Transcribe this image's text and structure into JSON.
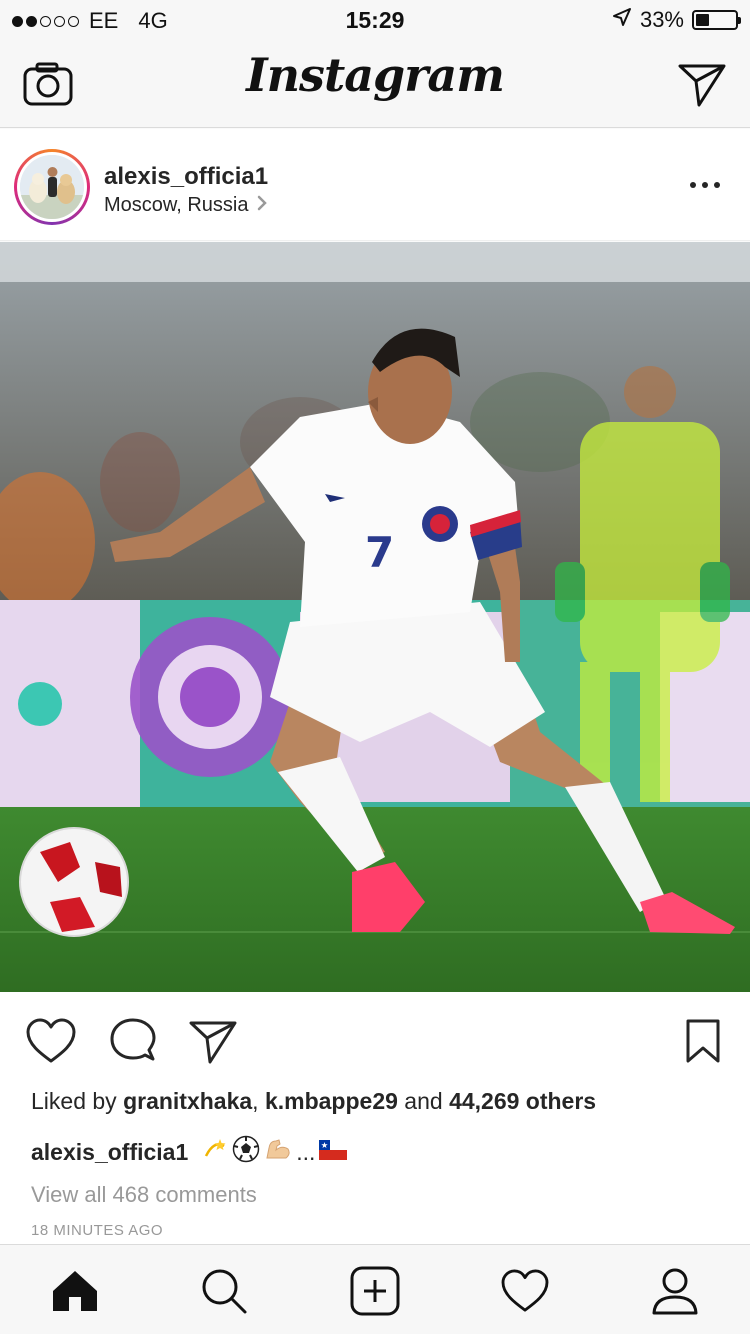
{
  "status_bar": {
    "carrier": "EE",
    "network": "4G",
    "time": "15:29",
    "battery": "33%",
    "battery_level": 0.33,
    "signal_bars": 2
  },
  "nav": {
    "brand": "Instagram",
    "left_icon": "camera-icon",
    "right_icon": "direct-message-icon"
  },
  "post": {
    "username": "alexis_officia1",
    "location": "Moscow, Russia",
    "likes_prefix": "Liked by",
    "liker_1": "granitxhaka",
    "comma": ",",
    "liker_2": "k.mbappe29",
    "and": "and",
    "others": "44,269 others",
    "caption_user": "alexis_officia1",
    "caption_ellipsis": "...",
    "caption_emoji": [
      "dizzy-icon",
      "soccer-ball-icon",
      "flexed-biceps-icon",
      "chile-flag-icon"
    ],
    "view_comments": "View all 468 comments",
    "time_ago": "18 MINUTES AGO"
  },
  "tabs": [
    "home-icon",
    "search-icon",
    "add-post-icon",
    "activity-heart-icon",
    "profile-icon"
  ],
  "colors": {
    "accent_text": "#262626",
    "muted": "#999999",
    "pitch_green": "#3d8a2e",
    "boot_pink": "#ff3f6a",
    "keeper_yellow": "#c8f03a"
  }
}
